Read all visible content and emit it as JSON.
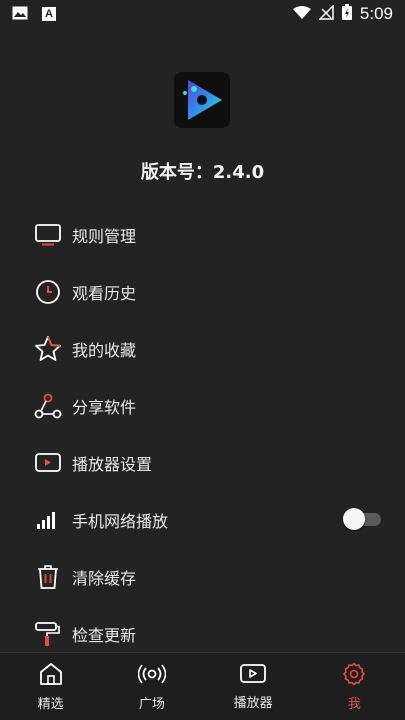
{
  "status_bar": {
    "time": "5:09",
    "notif_letter": "A"
  },
  "app": {
    "version_label": "版本号：2.4.0"
  },
  "menu": [
    {
      "label": "规则管理",
      "icon": "monitor-icon"
    },
    {
      "label": "观看历史",
      "icon": "clock-icon"
    },
    {
      "label": "我的收藏",
      "icon": "star-icon"
    },
    {
      "label": "分享软件",
      "icon": "share-icon"
    },
    {
      "label": "播放器设置",
      "icon": "player-icon"
    },
    {
      "label": "手机网络播放",
      "icon": "signal-bars-icon",
      "toggle_on": false
    },
    {
      "label": "清除缓存",
      "icon": "trash-icon"
    },
    {
      "label": "检查更新",
      "icon": "paint-roller-icon"
    }
  ],
  "nav": [
    {
      "label": "精选",
      "icon": "home-icon"
    },
    {
      "label": "广场",
      "icon": "broadcast-icon"
    },
    {
      "label": "播放器",
      "icon": "play-box-icon"
    },
    {
      "label": "我",
      "icon": "gear-icon",
      "active": true
    }
  ],
  "colors": {
    "accent": "#e74c3c",
    "background": "#232323"
  }
}
